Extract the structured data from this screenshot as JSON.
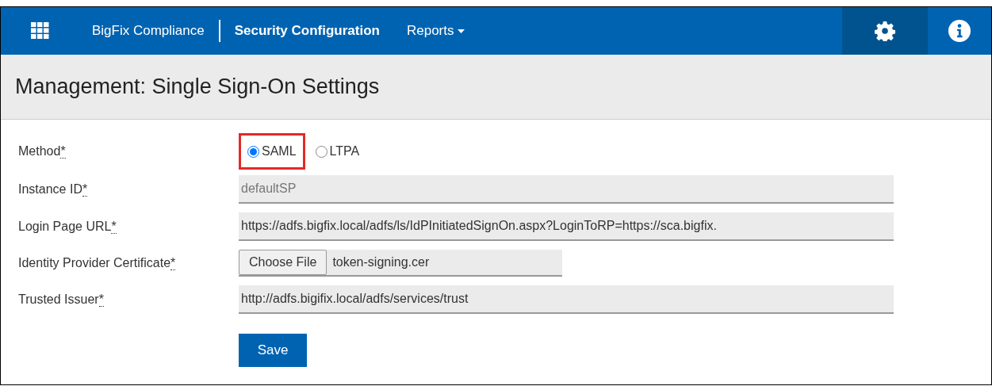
{
  "navbar": {
    "product": "BigFix Compliance",
    "items": [
      {
        "label": "Security Configuration",
        "selected": true,
        "dropdown": false
      },
      {
        "label": "Reports",
        "selected": false,
        "dropdown": true
      }
    ]
  },
  "page_title": "Management: Single Sign-On Settings",
  "form": {
    "fields": [
      {
        "kind": "radio",
        "label": "Method",
        "mark": "*",
        "options": [
          {
            "label": "SAML",
            "selected": true,
            "highlighted": true
          },
          {
            "label": "LTPA",
            "selected": false,
            "highlighted": false
          }
        ]
      },
      {
        "kind": "text",
        "label": "Instance ID",
        "mark": "*",
        "value": "defaultSP",
        "disabled": true
      },
      {
        "kind": "text",
        "label": "Login Page URL",
        "mark": "*",
        "value": "https://adfs.bigfix.local/adfs/ls/IdPInitiatedSignOn.aspx?LoginToRP=https://sca.bigfix.",
        "disabled": false
      },
      {
        "kind": "file",
        "label": "Identity Provider Certificate",
        "mark": "*",
        "button": "Choose File",
        "value": "token-signing.cer"
      },
      {
        "kind": "text",
        "label": "Trusted Issuer",
        "mark": "*",
        "value": "http://adfs.bigifix.local/adfs/services/trust",
        "disabled": false
      }
    ],
    "submit": "Save"
  }
}
